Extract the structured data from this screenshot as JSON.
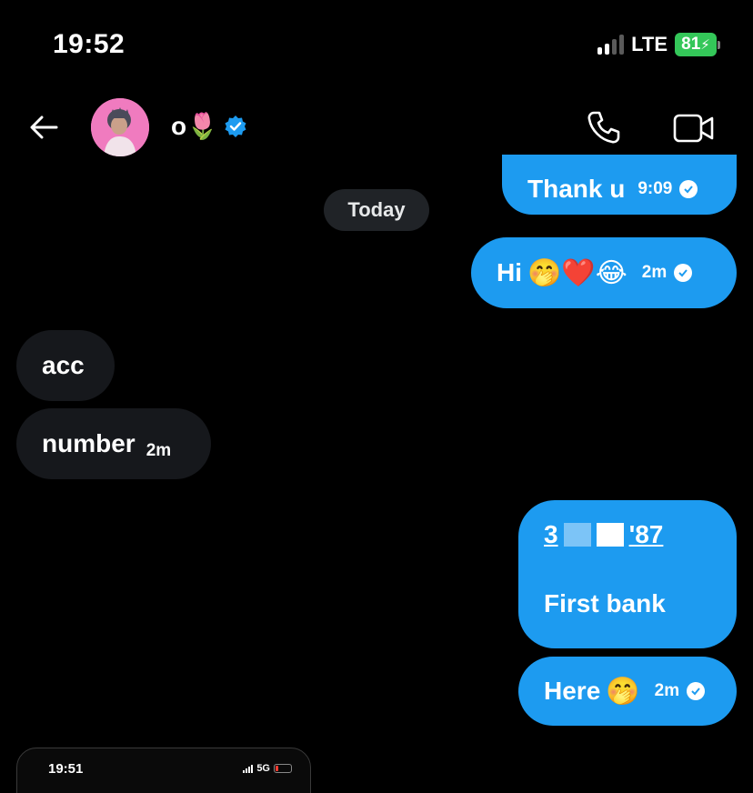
{
  "status_bar": {
    "time": "19:52",
    "network": "LTE",
    "battery": "81",
    "battery_color": "#34c759"
  },
  "header": {
    "contact_name": "o🌷",
    "verified": true,
    "back_icon": "arrow-left-icon",
    "call_icon": "phone-icon",
    "video_icon": "video-camera-icon",
    "avatar_bg": "#f07bbf"
  },
  "date_separator": "Today",
  "messages": [
    {
      "direction": "out",
      "text": "Thank u",
      "time": "9:09",
      "read": true
    },
    {
      "direction": "out",
      "text": "Hi",
      "emoji": "🤭❤️😂",
      "time": "2m",
      "read": true
    },
    {
      "direction": "in",
      "text": "acc"
    },
    {
      "direction": "in",
      "text": "number",
      "time": "2m"
    },
    {
      "direction": "out",
      "account_prefix": "3",
      "account_suffix": "'87",
      "text": "First bank"
    },
    {
      "direction": "out",
      "text": "Here",
      "emoji": "🤭",
      "time": "2m",
      "read": true
    }
  ],
  "colors": {
    "outgoing_bubble": "#1d9bf0",
    "incoming_bubble": "#16181c",
    "background": "#000000"
  },
  "preview": {
    "time": "19:51",
    "network": "5G"
  }
}
